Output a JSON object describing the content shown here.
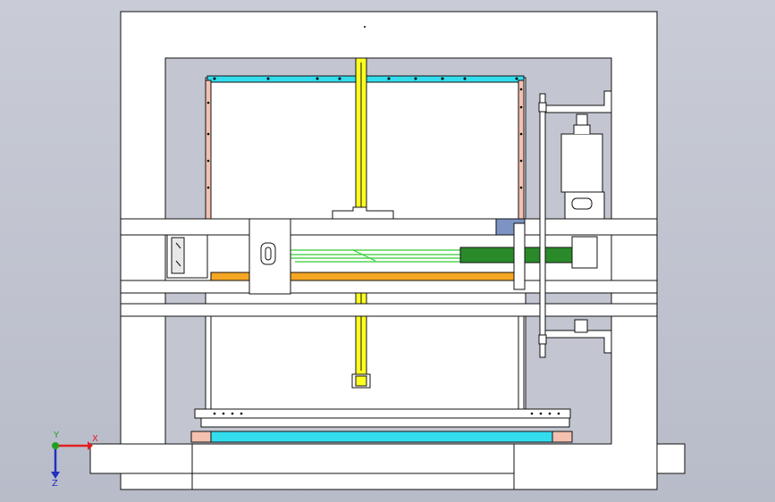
{
  "view": {
    "background": "#c3c6d1",
    "line_color": "#111111",
    "fill_white": "#ffffff"
  },
  "triad": {
    "x_label": "X",
    "y_label": "Y",
    "z_label": "Z",
    "x_color": "#e02020",
    "y_color": "#20a020",
    "z_color": "#2030c0"
  },
  "parts": {
    "beam_yellow": "#ffff22",
    "beam_cyan": "#33ddee",
    "beam_orange": "#f5a623",
    "beam_green": "#33cc33",
    "beam_pink": "#f4c0b0",
    "block_blue": "#7d93c4"
  }
}
